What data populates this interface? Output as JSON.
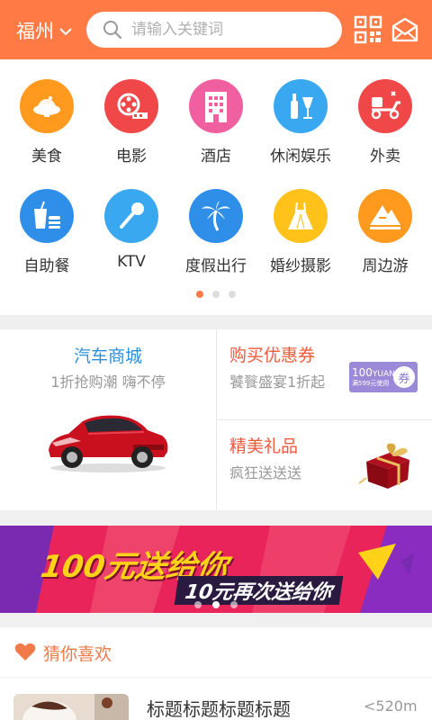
{
  "header": {
    "city": "福州",
    "search_placeholder": "请输入关键词",
    "qr_icon": "qr-code-icon",
    "message_icon": "envelope-icon"
  },
  "categories": [
    {
      "label": "美食",
      "icon": "food-dish-icon",
      "color": "#ff9a1f"
    },
    {
      "label": "电影",
      "icon": "film-reel-icon",
      "color": "#f04848"
    },
    {
      "label": "酒店",
      "icon": "hotel-building-icon",
      "color": "#f060a0"
    },
    {
      "label": "休闲娱乐",
      "icon": "drinks-icon",
      "color": "#3aa8f0"
    },
    {
      "label": "外卖",
      "icon": "delivery-scooter-icon",
      "color": "#f04848"
    },
    {
      "label": "自助餐",
      "icon": "buffet-icon",
      "color": "#2f8ee8"
    },
    {
      "label": "KTV",
      "icon": "microphone-icon",
      "color": "#3aa8f0"
    },
    {
      "label": "度假出行",
      "icon": "palm-tree-icon",
      "color": "#2f8ee8"
    },
    {
      "label": "婚纱摄影",
      "icon": "wedding-dress-icon",
      "color": "#ffc21a"
    },
    {
      "label": "周边游",
      "icon": "mountain-icon",
      "color": "#ff9a1f"
    }
  ],
  "category_page": {
    "count": 3,
    "active": 0
  },
  "promo": {
    "left": {
      "title": "汽车商城",
      "subtitle": "1折抢购潮 嗨不停",
      "image": "red-car-image"
    },
    "right_top": {
      "title": "购买优惠券",
      "subtitle": "饕餮盛宴1折起",
      "coupon_amount": "100",
      "coupon_unit": "YUAN",
      "coupon_note": "满599元使用",
      "coupon_tag": "券"
    },
    "right_bottom": {
      "title": "精美礼品",
      "subtitle": "疯狂送送送",
      "image": "gift-box-image"
    }
  },
  "banner": {
    "headline_num": "100元",
    "headline_text": "送给你",
    "subline_num": "10元",
    "subline_text": "再次送给你",
    "page_count": 3,
    "active": 1
  },
  "guess": {
    "title": "猜你喜欢",
    "icon": "heart-icon",
    "items": [
      {
        "title": "标题标题标题标题",
        "distance": "<520m"
      }
    ]
  },
  "colors": {
    "accent": "#ff7a45",
    "blue_text": "#2c8fd8",
    "red_text": "#f05a3c"
  }
}
